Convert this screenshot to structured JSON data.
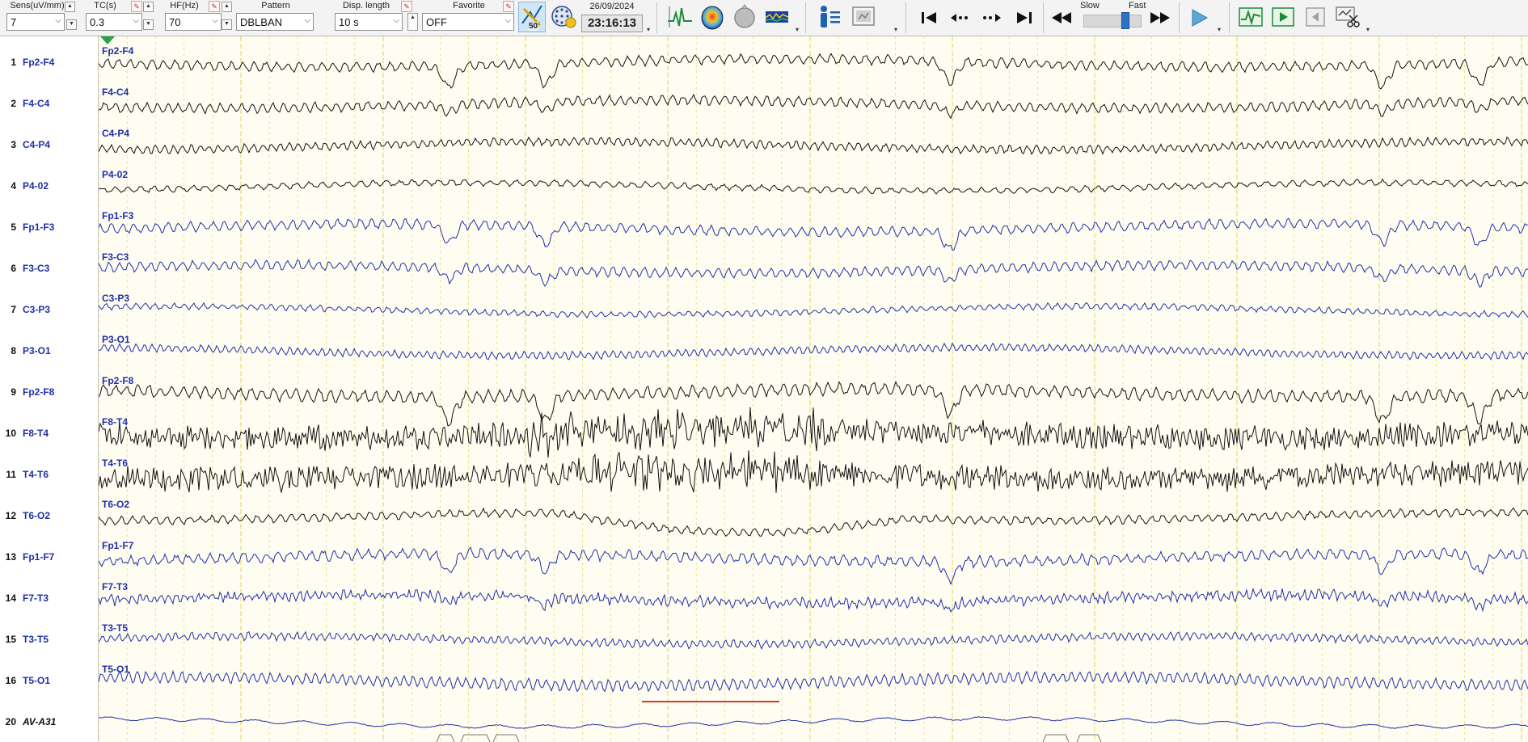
{
  "toolbar": {
    "sens": {
      "label": "Sens(uV/mm)",
      "value": "7"
    },
    "tc": {
      "label": "TC(s)",
      "value": "0.3"
    },
    "hf": {
      "label": "HF(Hz)",
      "value": "70"
    },
    "pattern": {
      "label": "Pattern",
      "value": "DBLBAN"
    },
    "disp_length": {
      "label": "Disp. length",
      "value": "10 s"
    },
    "favorite": {
      "label": "Favorite",
      "value": "OFF"
    },
    "filter_badge": "50",
    "date": "26/09/2024",
    "time": "23:16:13",
    "speed": {
      "slow_label": "Slow",
      "fast_label": "Fast",
      "level": 0.75
    }
  },
  "channels": [
    {
      "num": "1",
      "name": "Fp2-F4",
      "color": "#1f2fa8"
    },
    {
      "num": "2",
      "name": "F4-C4",
      "color": "#1f2fa8"
    },
    {
      "num": "3",
      "name": "C4-P4",
      "color": "#1f2fa8"
    },
    {
      "num": "4",
      "name": "P4-02",
      "color": "#1f2fa8"
    },
    {
      "num": "5",
      "name": "Fp1-F3",
      "color": "#1f2fa8"
    },
    {
      "num": "6",
      "name": "F3-C3",
      "color": "#1f2fa8"
    },
    {
      "num": "7",
      "name": "C3-P3",
      "color": "#1f2fa8"
    },
    {
      "num": "8",
      "name": "P3-O1",
      "color": "#1f2fa8"
    },
    {
      "num": "9",
      "name": "Fp2-F8",
      "color": "#1f2fa8"
    },
    {
      "num": "10",
      "name": "F8-T4",
      "color": "#1f2fa8"
    },
    {
      "num": "11",
      "name": "T4-T6",
      "color": "#1f2fa8"
    },
    {
      "num": "12",
      "name": "T6-O2",
      "color": "#1f2fa8"
    },
    {
      "num": "13",
      "name": "Fp1-F7",
      "color": "#1f2fa8"
    },
    {
      "num": "14",
      "name": "F7-T3",
      "color": "#1f2fa8"
    },
    {
      "num": "15",
      "name": "T3-T5",
      "color": "#1f2fa8"
    },
    {
      "num": "16",
      "name": "T5-O1",
      "color": "#1f2fa8"
    },
    {
      "num": "20",
      "name": "AV-A31",
      "color": "#111111"
    }
  ],
  "traces": [
    {
      "label": "Fp2-F4",
      "color": "#111111"
    },
    {
      "label": "F4-C4",
      "color": "#111111"
    },
    {
      "label": "C4-P4",
      "color": "#111111"
    },
    {
      "label": "P4-02",
      "color": "#111111"
    },
    {
      "label": "Fp1-F3",
      "color": "#1f2fa8"
    },
    {
      "label": "F3-C3",
      "color": "#1f2fa8"
    },
    {
      "label": "C3-P3",
      "color": "#1f2fa8"
    },
    {
      "label": "P3-O1",
      "color": "#1f2fa8"
    },
    {
      "label": "Fp2-F8",
      "color": "#111111"
    },
    {
      "label": "F8-T4",
      "color": "#111111"
    },
    {
      "label": "T4-T6",
      "color": "#111111"
    },
    {
      "label": "T6-O2",
      "color": "#111111"
    },
    {
      "label": "Fp1-F7",
      "color": "#1f2fa8"
    },
    {
      "label": "F7-T3",
      "color": "#1f2fa8"
    },
    {
      "label": "T3-T5",
      "color": "#1f2fa8"
    },
    {
      "label": "T5-O1",
      "color": "#1f2fa8"
    },
    {
      "label": "",
      "color": "#1f2fa8"
    }
  ],
  "colors": {
    "canvas_bg": "#fffdf2",
    "gridline": "#e8d96a",
    "marker": "#d93a2b",
    "sync_marker": "#2ea043"
  }
}
